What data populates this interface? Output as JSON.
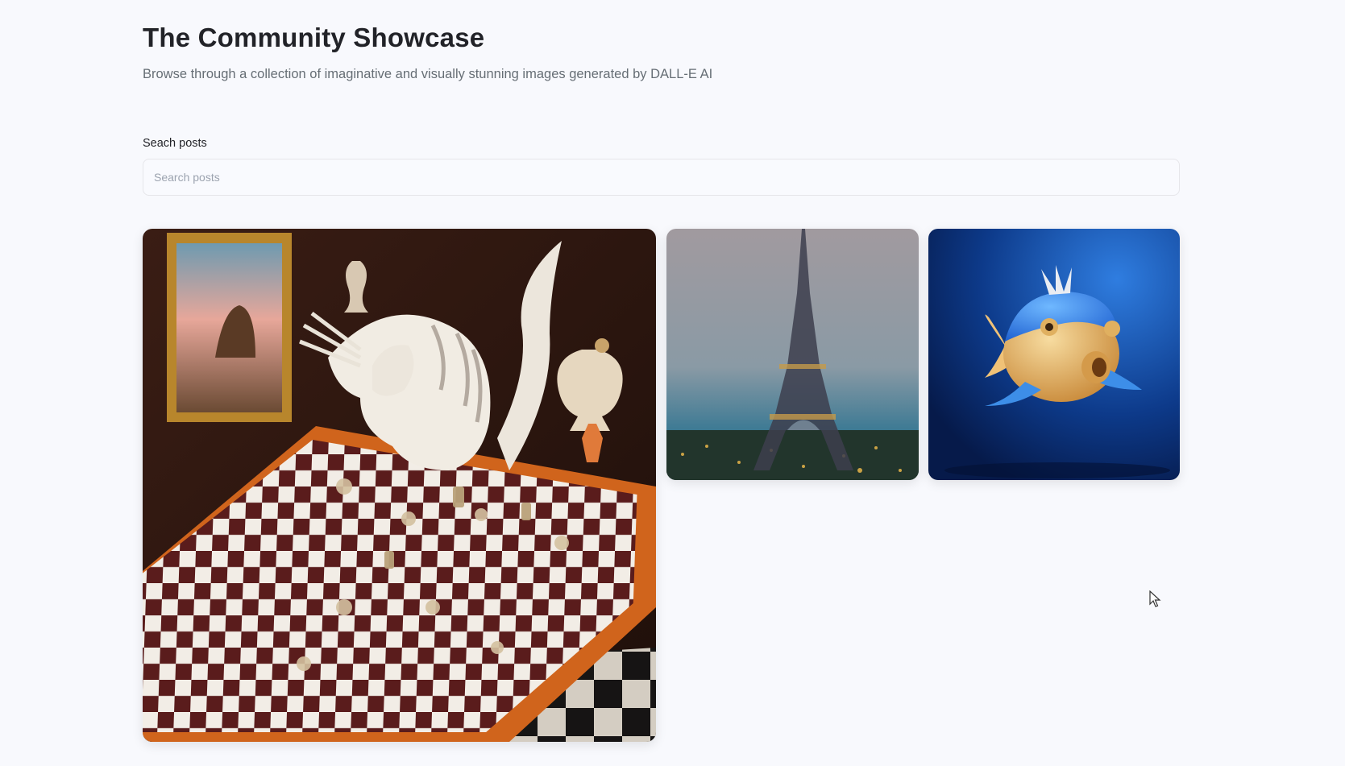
{
  "header": {
    "title": "The Community Showcase",
    "subtitle": "Browse through a collection of imaginative and visually stunning images generated by DALL-E AI"
  },
  "search": {
    "label": "Seach posts",
    "placeholder": "Search posts",
    "value": ""
  },
  "posts": [
    {
      "icon": "cat-chess-painting-image"
    },
    {
      "icon": "eiffel-tower-painting-image"
    },
    {
      "icon": "blue-fish-3d-image"
    }
  ],
  "colors": {
    "background": "#f8f9fd",
    "title": "#222328",
    "subtitle": "#666e75"
  }
}
